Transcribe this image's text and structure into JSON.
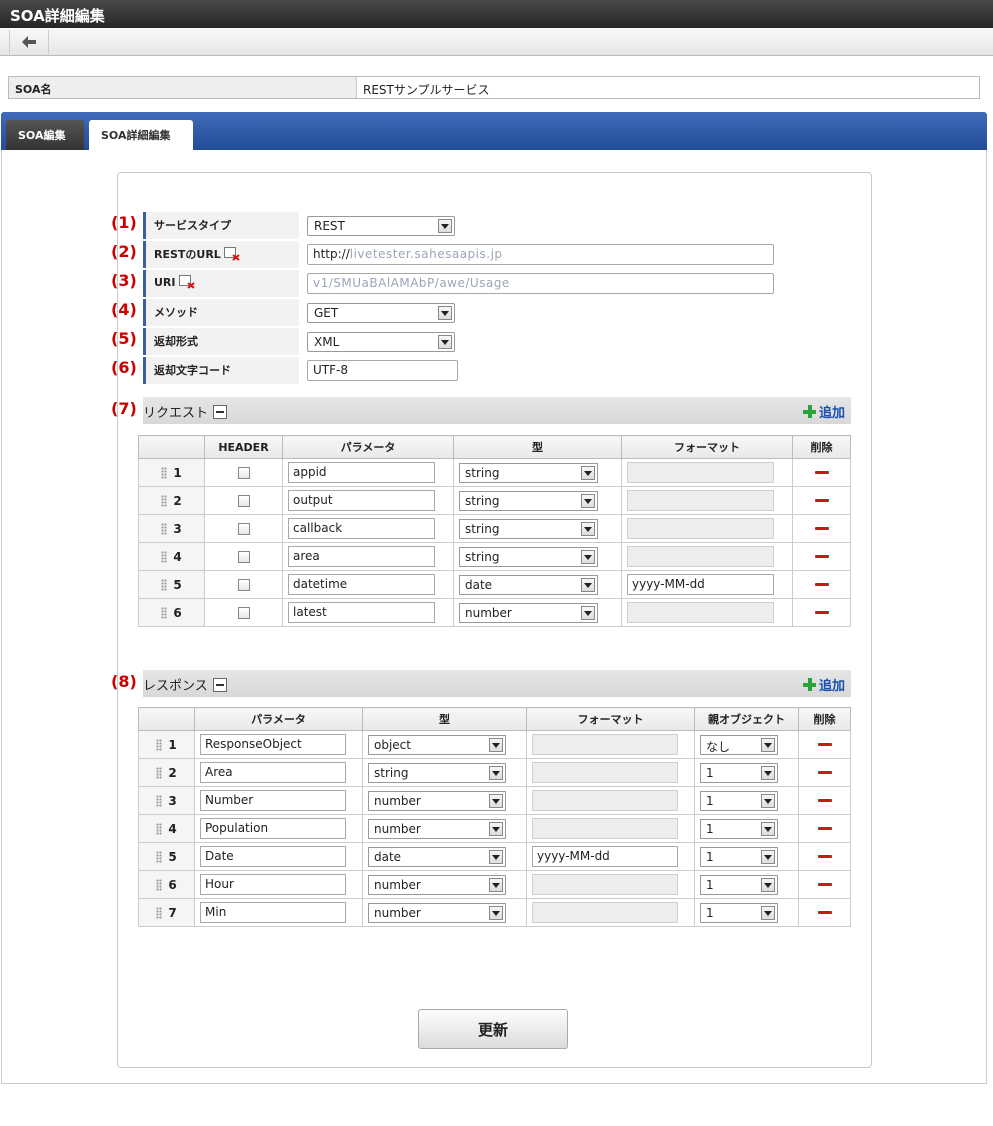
{
  "window": {
    "title": "SOA詳細編集"
  },
  "soa_name": {
    "label": "SOA名",
    "value": "RESTサンプルサービス"
  },
  "tabs": [
    {
      "label": "SOA編集"
    },
    {
      "label": "SOA詳細編集"
    }
  ],
  "numbers": [
    "(1)",
    "(2)",
    "(3)",
    "(4)",
    "(5)",
    "(6)",
    "(7)",
    "(8)"
  ],
  "form": {
    "service_type": {
      "label": "サービスタイプ",
      "value": "REST"
    },
    "rest_url": {
      "label": "RESTのURL",
      "prefix": "http://",
      "blurred": "livetester.sahesaapis.jp"
    },
    "uri": {
      "label": "URI",
      "blurred": "v1/SMUaBAlAMAbP/awe/Usage"
    },
    "method": {
      "label": "メソッド",
      "value": "GET"
    },
    "return_format": {
      "label": "返却形式",
      "value": "XML"
    },
    "return_charset": {
      "label": "返却文字コード",
      "value": "UTF-8"
    }
  },
  "request": {
    "title": "リクエスト",
    "add_label": "追加",
    "headers": [
      "HEADER",
      "パラメータ",
      "型",
      "フォーマット",
      "削除"
    ],
    "rows": [
      {
        "no": "1",
        "param": "appid",
        "type": "string",
        "format": ""
      },
      {
        "no": "2",
        "param": "output",
        "type": "string",
        "format": ""
      },
      {
        "no": "3",
        "param": "callback",
        "type": "string",
        "format": ""
      },
      {
        "no": "4",
        "param": "area",
        "type": "string",
        "format": ""
      },
      {
        "no": "5",
        "param": "datetime",
        "type": "date",
        "format": "yyyy-MM-dd"
      },
      {
        "no": "6",
        "param": "latest",
        "type": "number",
        "format": ""
      }
    ]
  },
  "response": {
    "title": "レスポンス",
    "add_label": "追加",
    "headers": [
      "パラメータ",
      "型",
      "フォーマット",
      "親オブジェクト",
      "削除"
    ],
    "rows": [
      {
        "no": "1",
        "param": "ResponseObject",
        "type": "object",
        "format": "",
        "parent": "なし"
      },
      {
        "no": "2",
        "param": "Area",
        "type": "string",
        "format": "",
        "parent": "1"
      },
      {
        "no": "3",
        "param": "Number",
        "type": "number",
        "format": "",
        "parent": "1"
      },
      {
        "no": "4",
        "param": "Population",
        "type": "number",
        "format": "",
        "parent": "1"
      },
      {
        "no": "5",
        "param": "Date",
        "type": "date",
        "format": "yyyy-MM-dd",
        "parent": "1"
      },
      {
        "no": "6",
        "param": "Hour",
        "type": "number",
        "format": "",
        "parent": "1"
      },
      {
        "no": "7",
        "param": "Min",
        "type": "number",
        "format": "",
        "parent": "1"
      }
    ]
  },
  "update_button": {
    "label": "更新"
  }
}
